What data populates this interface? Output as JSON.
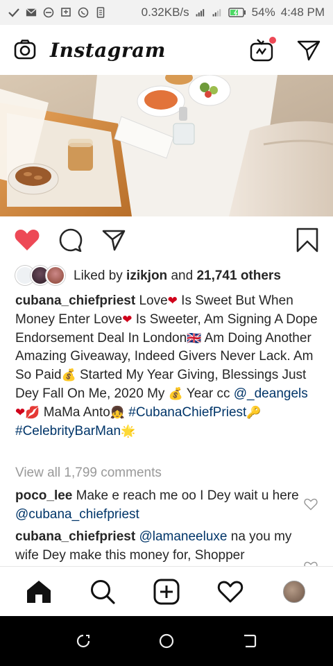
{
  "status_bar": {
    "speed": "0.32KB/s",
    "battery": "54%",
    "time": "4:48 PM"
  },
  "app": {
    "title": "Instagram"
  },
  "post": {
    "likes_prefix": "Liked by ",
    "liked_by_user": "izikjon",
    "likes_joiner": " and ",
    "likes_count": "21,741 others",
    "caption_user": "cubana_chiefpriest",
    "caption_parts": {
      "p1": " Love",
      "p2": " Is Sweet But When Money Enter Love",
      "p3": " Is Sweeter, Am Signing A Dope Endorsement Deal In London",
      "p4": " Am Doing Another Amazing Giveaway, Indeed Givers Never Lack. Am So Paid",
      "p5": " Started My Year Giving, Blessings Just Dey Fall On Me, 2020 My ",
      "p6": " Year cc ",
      "mention": "@_deangels",
      "p7": " MaMa Anto",
      "hashtag1": "#CubanaChiefPriest",
      "hashtag2": "#CelebrityBarMan"
    },
    "emojis": {
      "heart": "❤",
      "flag": "🇬🇧",
      "moneybag": "💰",
      "kiss": "💋",
      "girl": "👧",
      "key": "🔑",
      "star": "🌟"
    },
    "view_all": "View all 1,799 comments",
    "comments": [
      {
        "user": "poco_lee",
        "text": " Make e reach me oo I Dey wait u here ",
        "mention": "@cubana_chiefpriest"
      },
      {
        "user": "cubana_chiefpriest",
        "mention": " @lamaneeluxe",
        "text": " na you my wife Dey make this money for, Shopper"
      }
    ]
  },
  "colors": {
    "like_red": "#ed4956",
    "link_blue": "#003569",
    "muted_gray": "#999999"
  },
  "icons": {
    "camera": "camera-icon",
    "igtv": "igtv-icon",
    "direct": "direct-message-icon",
    "like": "heart-filled-icon",
    "comment": "comment-icon",
    "share": "share-icon",
    "save": "bookmark-icon",
    "home": "home-icon",
    "search": "search-icon",
    "add": "add-post-icon",
    "activity": "activity-heart-icon"
  }
}
